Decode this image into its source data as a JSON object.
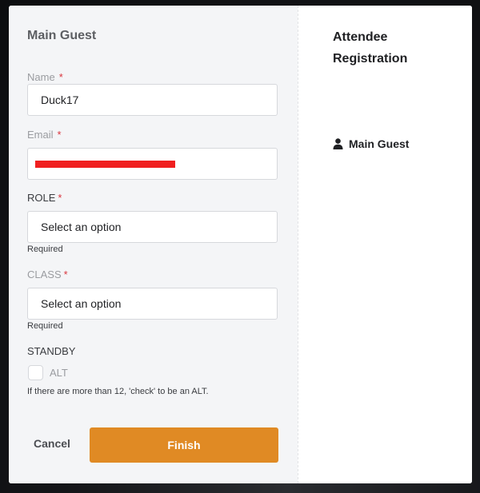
{
  "form": {
    "title": "Main Guest",
    "name": {
      "label": "Name",
      "required_mark": "*",
      "value": "Duck17"
    },
    "email": {
      "label": "Email",
      "required_mark": "*",
      "value": ""
    },
    "role": {
      "label": "ROLE",
      "required_mark": "*",
      "value": "Select an option",
      "helper": "Required"
    },
    "class": {
      "label": "CLASS",
      "required_mark": "*",
      "value": "Select an option",
      "helper": "Required"
    },
    "standby": {
      "label": "STANDBY",
      "checkbox_label": "ALT",
      "checked": false,
      "help": "If there are more than 12, 'check' to be an ALT."
    },
    "actions": {
      "cancel_label": "Cancel",
      "finish_label": "Finish"
    }
  },
  "sidebar": {
    "title": "Attendee Registration",
    "items": [
      {
        "label": "Main Guest",
        "icon": "person-icon"
      }
    ]
  },
  "colors": {
    "accent": "#e08a24",
    "required": "#d9363e",
    "redaction": "#f01f1f"
  }
}
